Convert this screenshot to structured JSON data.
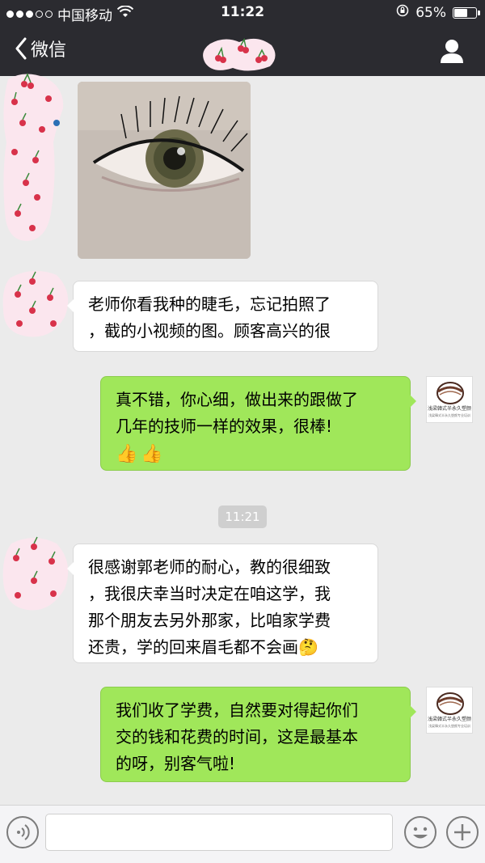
{
  "status": {
    "carrier": "中国移动",
    "time": "11:22",
    "battery": "65%",
    "battery_level": 0.65
  },
  "nav": {
    "back_label": "微信"
  },
  "messages": [
    {
      "side": "left",
      "type": "image",
      "description_icon": "eye-photo"
    },
    {
      "side": "left",
      "type": "text",
      "lines": [
        "老师你看我种的睫毛，忘记拍照了",
        "，截的小视频的图。顾客高兴的很"
      ]
    },
    {
      "side": "right",
      "type": "text",
      "lines": [
        "真不错，你心细，做出来的跟做了",
        "几年的技师一样的效果，很棒!"
      ],
      "emoji": [
        "thumbs-up-icon",
        "thumbs-up-icon"
      ]
    },
    {
      "side": "left",
      "type": "text",
      "lines": [
        "很感谢郭老师的耐心，教的很细致",
        "，我很庆幸当时决定在咱这学，我",
        "那个朋友去另外那家，比咱家学费",
        "还贵，学的回来眉毛都不会画"
      ],
      "emoji": [
        "thinking-face-icon"
      ]
    },
    {
      "side": "right",
      "type": "text",
      "lines": [
        "我们收了学费，自然要对得起你们",
        "交的钱和花费的时间，这是最基本",
        "的呀，别客气啦!"
      ]
    }
  ],
  "timestamp": "11:21",
  "brand": {
    "name": "浅梁韓式半永久塑颜",
    "sub": "浅梁韓式半永久塑颜专业培训"
  },
  "colors": {
    "bar": "#2b2b30",
    "green_bubble": "#a0e75a",
    "background": "#ebebeb"
  }
}
